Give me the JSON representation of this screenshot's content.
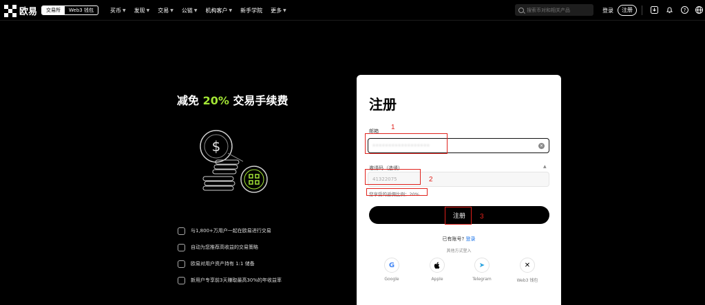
{
  "nav": {
    "logo_text": "欧易",
    "mode_exchange": "交易所",
    "mode_web3": "Web3 钱包",
    "menu": [
      "买币",
      "发现",
      "交易",
      "公链",
      "机构客户",
      "新手学院",
      "更多"
    ],
    "menu_has_chevron": [
      true,
      true,
      true,
      true,
      true,
      false,
      true
    ],
    "search_placeholder": "搜索币对和相关产品",
    "login": "登录",
    "register": "注册"
  },
  "promo": {
    "title_prefix": "减免 ",
    "title_highlight": "20%",
    "title_suffix": " 交易手续费",
    "highlight_color": "#a3e635",
    "benefits": [
      "与1,800+万用户一起在欧易进行交易",
      "自动为您推荐高收益的交易策略",
      "欧易对用户资产持有 1:1 储备",
      "新用户专享前3天赚取最高30%的年收益率"
    ]
  },
  "form": {
    "title": "注册",
    "email_label": "邮箱",
    "email_value": "••••••••••••••••••",
    "code_label": "邀请码（选填）",
    "code_value": "41322075",
    "hint": "您享受的返佣比例：20%",
    "submit": "注册",
    "has_account": "已有账号?",
    "login_link": "登录",
    "other_methods": "其他方式登入",
    "social": [
      {
        "label": "Google",
        "glyph": "G",
        "color": "#4285f4"
      },
      {
        "label": "Apple",
        "glyph": "",
        "color": "#000000"
      },
      {
        "label": "Telegram",
        "glyph": "➤",
        "color": "#2aa3df"
      },
      {
        "label": "Web3 钱包",
        "glyph": "✕",
        "color": "#000000"
      }
    ]
  },
  "annotations": [
    "1",
    "2",
    "3"
  ]
}
